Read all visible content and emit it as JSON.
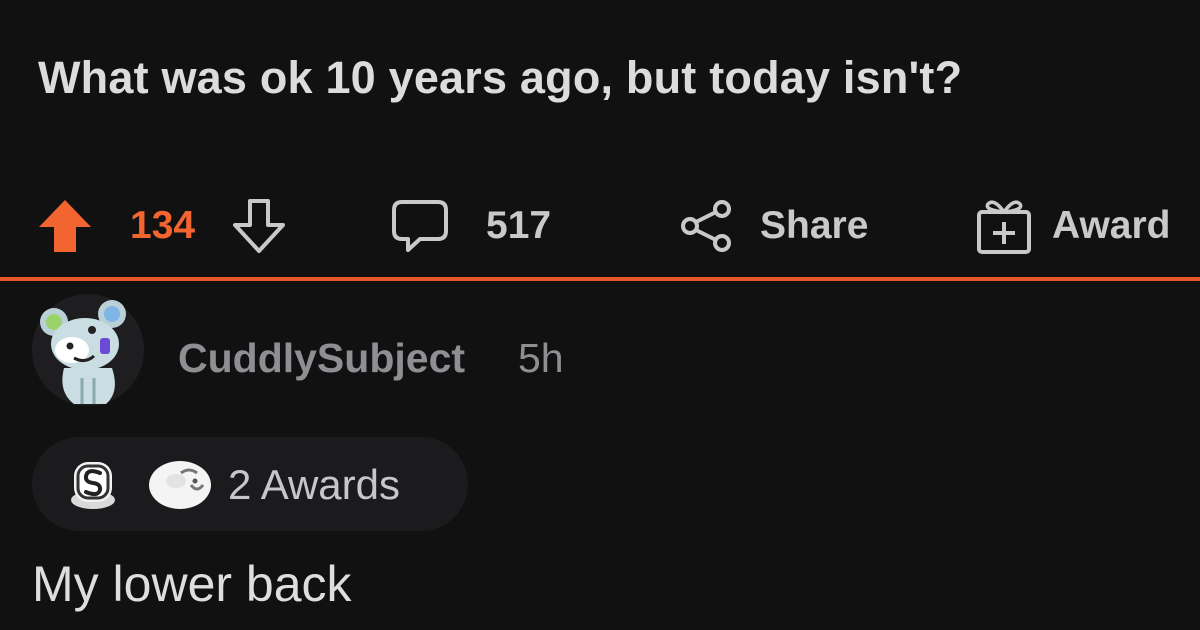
{
  "post": {
    "title": "What was ok 10 years ago, but today isn't?"
  },
  "actions": {
    "upvote_count": "134",
    "comment_count": "517",
    "share_label": "Share",
    "award_label": "Award",
    "upvote_color": "#f26430"
  },
  "comment": {
    "username": "CuddlySubject",
    "timestamp": "5h",
    "awards_label": "2 Awards",
    "body": "My lower back"
  },
  "colors": {
    "background": "#111112",
    "accent": "#e8552b",
    "muted_text": "#8f8f93"
  },
  "icons": [
    "upvote-arrow-icon",
    "downvote-arrow-icon",
    "comment-bubble-icon",
    "share-icon",
    "gift-award-icon",
    "snoo-avatar-icon",
    "silver-award-icon",
    "wholesome-award-icon"
  ]
}
